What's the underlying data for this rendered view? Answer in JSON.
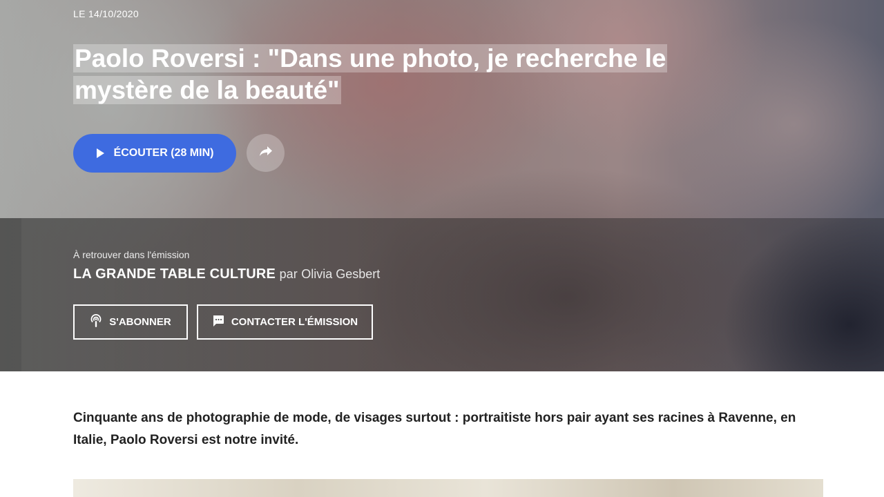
{
  "article": {
    "date": "LE 14/10/2020",
    "title": "Paolo Roversi : \"Dans une photo, je recherche le mystère de la beauté\"",
    "listen_label": "ÉCOUTER (28 MIN)"
  },
  "emission": {
    "intro": "À retrouver dans l'émission",
    "name": "LA GRANDE TABLE CULTURE",
    "by": "par",
    "host": "Olivia Gesbert",
    "subscribe_label": "S'ABONNER",
    "contact_label": "CONTACTER L'ÉMISSION"
  },
  "body": {
    "intro": "Cinquante ans de photographie de mode, de visages surtout : portraitiste hors pair ayant ses racines à Ravenne, en Italie, Paolo Roversi est notre invité."
  },
  "icons": {
    "play": "play-icon",
    "share": "share-icon",
    "podcast": "podcast-icon",
    "message": "message-icon"
  },
  "colors": {
    "accent": "#3e6be0"
  }
}
